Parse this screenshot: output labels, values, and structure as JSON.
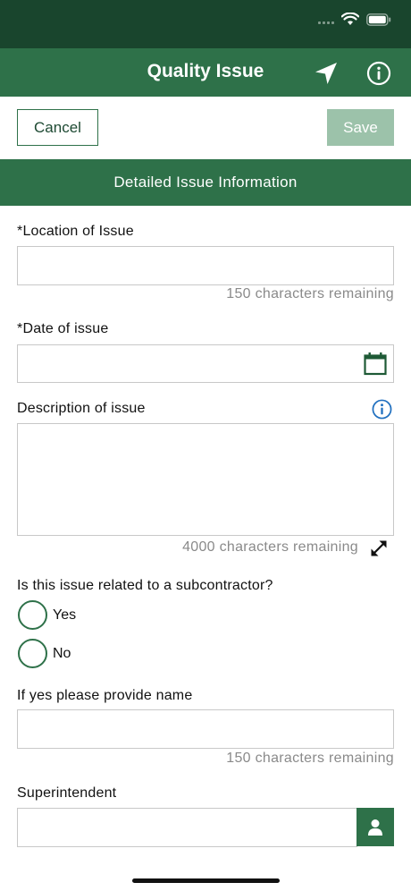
{
  "header": {
    "title": "Quality Issue",
    "location_icon": "navigation-arrow-icon",
    "info_icon": "info-circle-icon"
  },
  "toolbar": {
    "cancel_label": "Cancel",
    "save_label": "Save"
  },
  "section": {
    "title": "Detailed Issue Information"
  },
  "form": {
    "location": {
      "required_mark": "*",
      "label": "Location of Issue",
      "value": "",
      "counter": "150 characters remaining"
    },
    "date": {
      "required_mark": "*",
      "label": "Date of issue",
      "value": "",
      "icon": "calendar-icon"
    },
    "description": {
      "label": "Description of issue",
      "value": "",
      "counter": "4000 characters remaining",
      "info_icon": "info-circle-icon",
      "expand_icon": "expand-arrows-icon"
    },
    "subcontractor": {
      "question": "Is this issue related to a subcontractor?",
      "options": [
        "Yes",
        "No"
      ],
      "selected": null
    },
    "subcontractor_name": {
      "label": "If yes please provide name",
      "value": "",
      "counter": "150 characters remaining"
    },
    "superintendent": {
      "label": "Superintendent",
      "value": "",
      "icon": "person-icon"
    }
  },
  "colors": {
    "status_bar": "#19452d",
    "primary": "#2e7149",
    "save_disabled": "#9cc2aa",
    "info_blue": "#1f6fbf",
    "counter_gray": "#8a8a8a"
  }
}
